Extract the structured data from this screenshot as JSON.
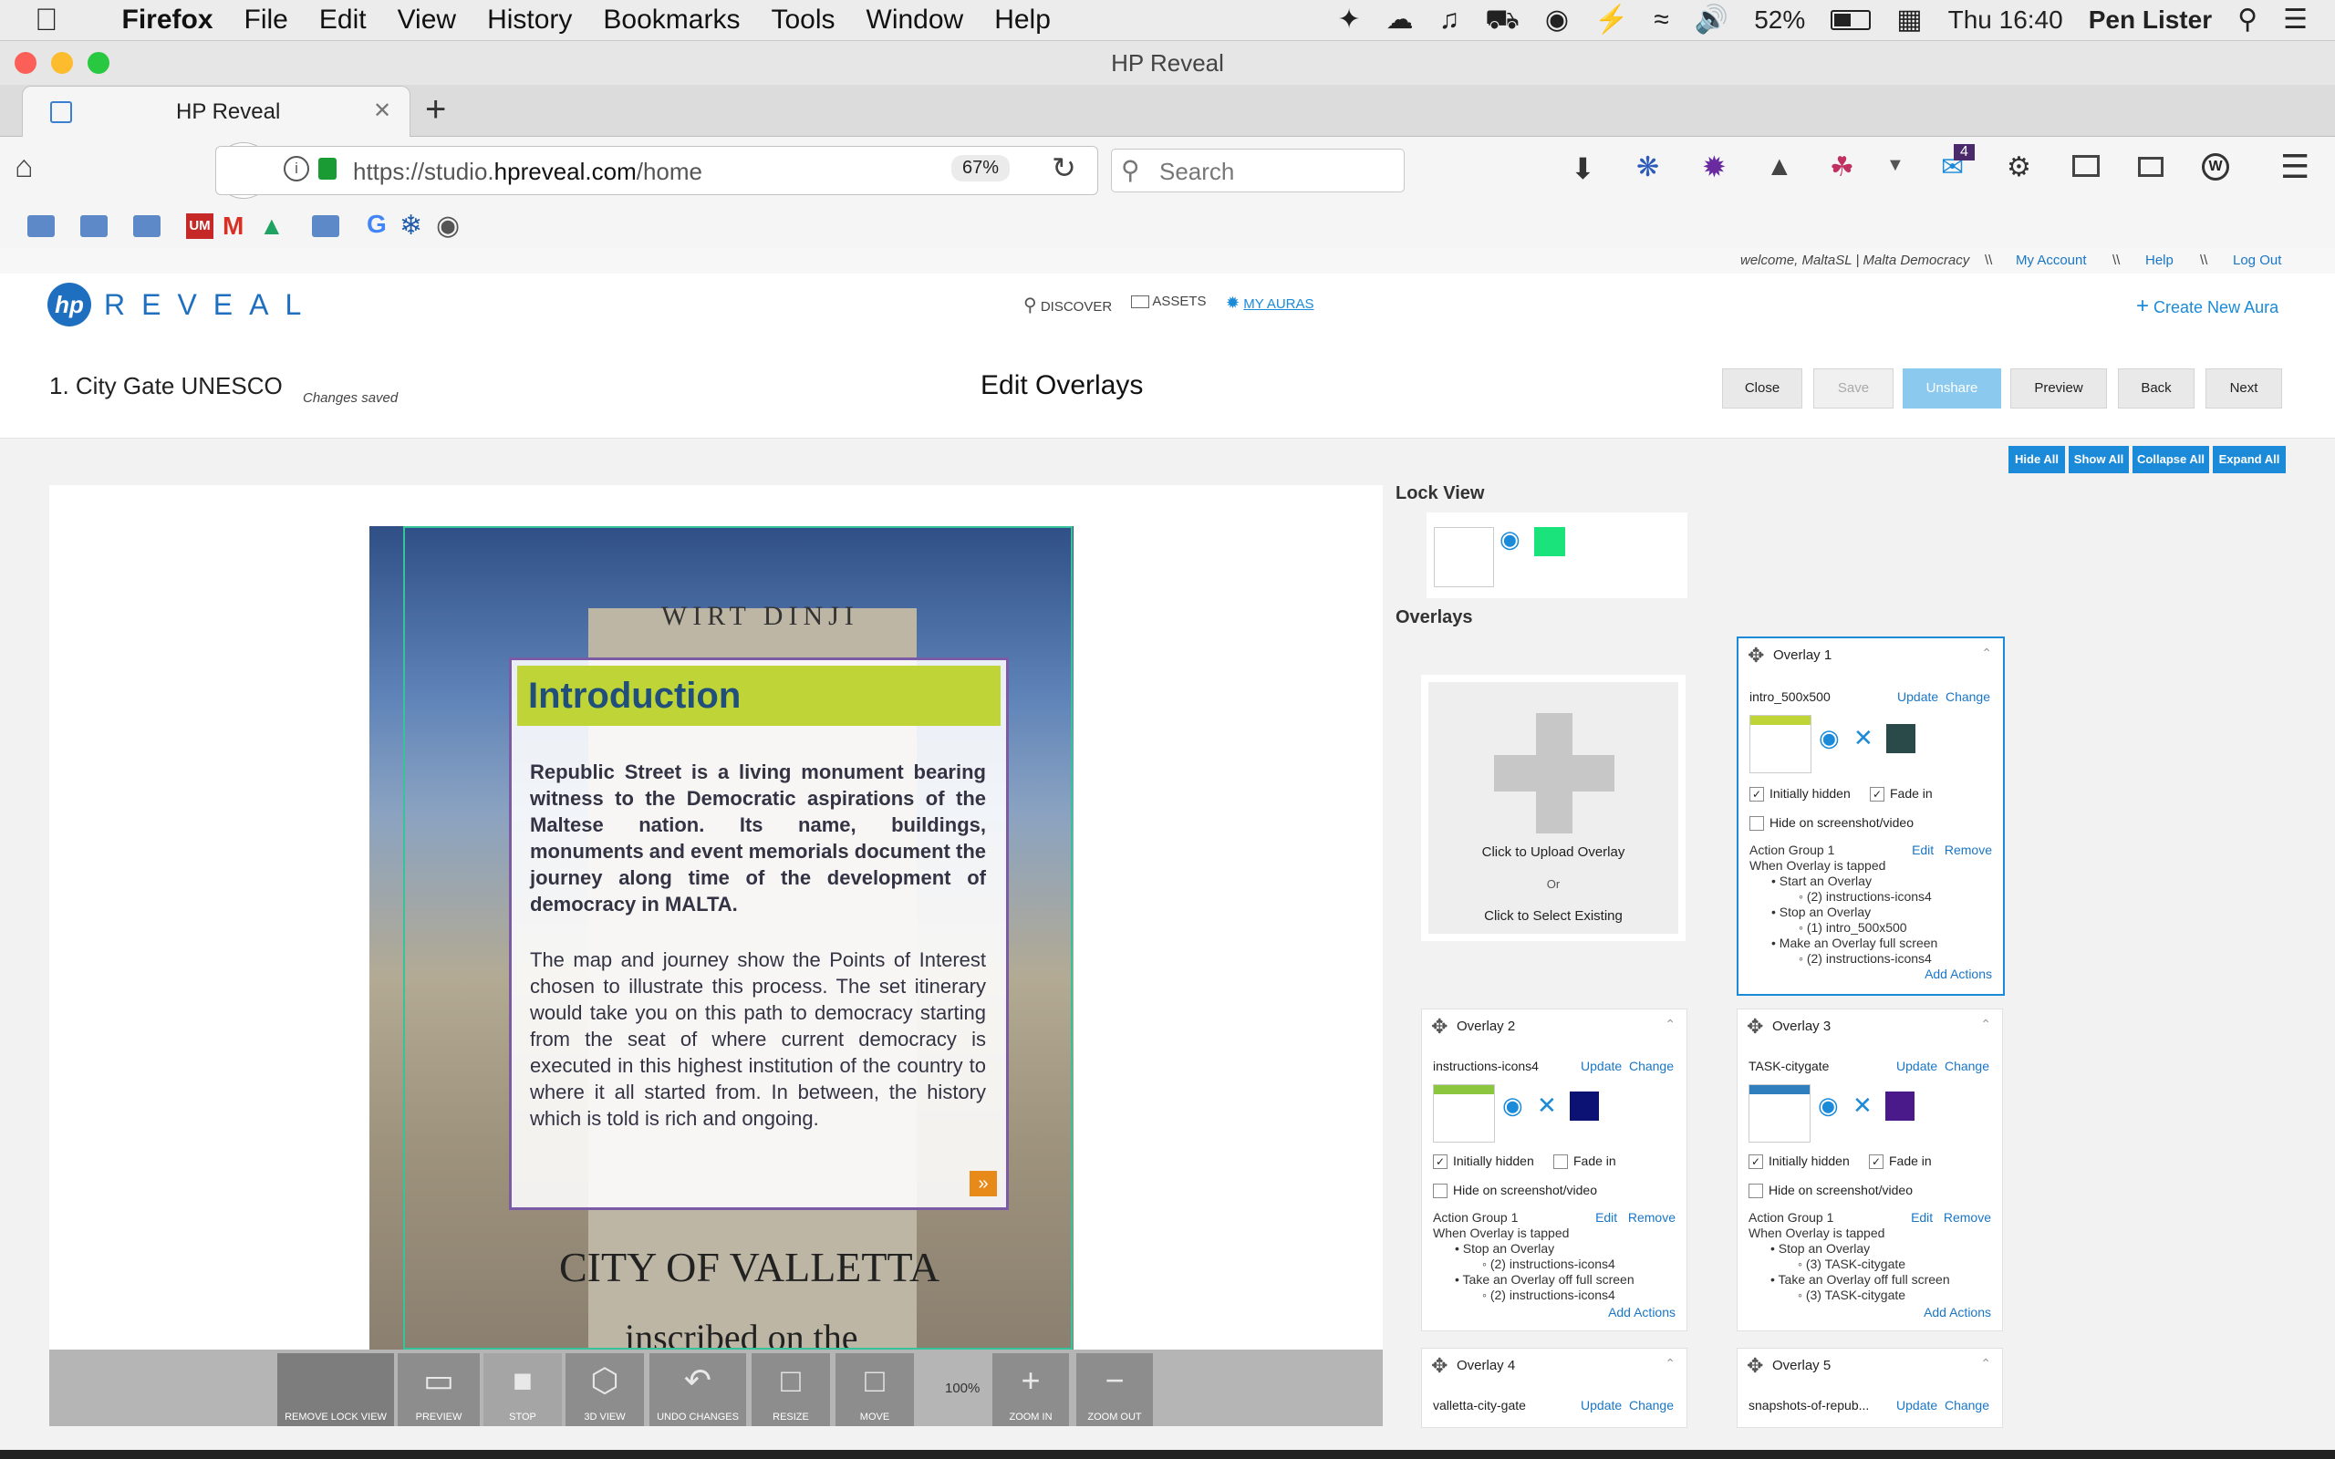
{
  "mac_menu": {
    "items": [
      "Firefox",
      "File",
      "Edit",
      "View",
      "History",
      "Bookmarks",
      "Tools",
      "Window",
      "Help"
    ],
    "battery": "52%",
    "clock": "Thu 16:40",
    "user": "Pen Lister"
  },
  "browser": {
    "window_title": "HP Reveal",
    "tab_title": "HP Reveal",
    "url_prefix": "https://studio.",
    "url_domain": "hpreveal.com",
    "url_path": "/home",
    "zoom": "67%",
    "search_placeholder": "Search",
    "notification_badge": "4"
  },
  "account_bar": {
    "welcome": "welcome, MaltaSL | Malta Democracy",
    "sep": "\\\\",
    "my_account": "My Account",
    "help": "Help",
    "logout": "Log Out"
  },
  "app": {
    "logo": "hp",
    "brand": "REVEAL",
    "nav": {
      "discover": "DISCOVER",
      "assets": "ASSETS",
      "my_auras": "MY AURAS"
    },
    "create": "Create New Aura"
  },
  "edit": {
    "aura_title": "1. City Gate UNESCO",
    "status": "Changes saved",
    "heading": "Edit Overlays",
    "buttons": {
      "close": "Close",
      "save": "Save",
      "unshare": "Unshare",
      "preview": "Preview",
      "back": "Back",
      "next": "Next"
    },
    "panel_buttons": {
      "hide_all": "Hide All",
      "show_all": "Show All",
      "collapse_all": "Collapse All",
      "expand_all": "Expand All"
    }
  },
  "canvas": {
    "intro_title": "Introduction",
    "intro_p1": "Republic Street is a living monument bearing witness to the Democratic aspirations of the Maltese nation. Its name, buildings, monuments and event memorials document the journey along time of the development of democracy in MALTA.",
    "intro_p2": "The map and journey show the Points of Interest chosen to illustrate this process. The set itinerary would take you on this path to democracy starting from the seat of where current democracy is executed in this highest institution of the country to where it all started from. In between, the history which is told is rich and ongoing.",
    "sign_top": "WIRT DINJI",
    "sign_city": "CITY OF VALLETTA",
    "sign_bottom": "inscribed on the",
    "zoom_level": "100%",
    "toolbar": {
      "remove_lock": "REMOVE LOCK VIEW",
      "preview": "PREVIEW",
      "stop": "STOP",
      "view3d": "3D VIEW",
      "undo": "UNDO CHANGES",
      "resize": "RESIZE",
      "move": "MOVE",
      "zoom_in": "ZOOM IN",
      "zoom_out": "ZOOM OUT"
    }
  },
  "lock_view": {
    "title": "Lock View",
    "color": "#19e37a"
  },
  "overlays_panel": {
    "title": "Overlays",
    "upload": "Click to Upload Overlay",
    "or": "Or",
    "select_existing": "Click to Select Existing"
  },
  "overlays": [
    {
      "title": "Overlay 1",
      "name": "intro_500x500",
      "update": "Update",
      "change": "Change",
      "color": "#2a4a4a",
      "initially_hidden": "Initially hidden",
      "fade_in": "Fade in",
      "hide_screenshot": "Hide on screenshot/video",
      "hidden_checked": true,
      "fade_checked": true,
      "screenshot_checked": false,
      "group": "Action Group 1",
      "edit": "Edit",
      "remove": "Remove",
      "trigger": "When Overlay is tapped",
      "actions": [
        {
          "action": "Start an Overlay",
          "target": "(2) instructions-icons4"
        },
        {
          "action": "Stop an Overlay",
          "target": "(1) intro_500x500"
        },
        {
          "action": "Make an Overlay full screen",
          "target": "(2) instructions-icons4"
        }
      ],
      "add_actions": "Add Actions"
    },
    {
      "title": "Overlay 2",
      "name": "instructions-icons4",
      "update": "Update",
      "change": "Change",
      "color": "#0c1273",
      "initially_hidden": "Initially hidden",
      "fade_in": "Fade in",
      "hide_screenshot": "Hide on screenshot/video",
      "hidden_checked": true,
      "fade_checked": false,
      "screenshot_checked": false,
      "group": "Action Group 1",
      "edit": "Edit",
      "remove": "Remove",
      "trigger": "When Overlay is tapped",
      "actions": [
        {
          "action": "Stop an Overlay",
          "target": "(2) instructions-icons4"
        },
        {
          "action": "Take an Overlay off full screen",
          "target": "(2) instructions-icons4"
        }
      ],
      "add_actions": "Add Actions"
    },
    {
      "title": "Overlay 3",
      "name": "TASK-citygate",
      "update": "Update",
      "change": "Change",
      "color": "#4b1a8a",
      "initially_hidden": "Initially hidden",
      "fade_in": "Fade in",
      "hide_screenshot": "Hide on screenshot/video",
      "hidden_checked": true,
      "fade_checked": true,
      "screenshot_checked": false,
      "group": "Action Group 1",
      "edit": "Edit",
      "remove": "Remove",
      "trigger": "When Overlay is tapped",
      "actions": [
        {
          "action": "Stop an Overlay",
          "target": "(3) TASK-citygate"
        },
        {
          "action": "Take an Overlay off full screen",
          "target": "(3) TASK-citygate"
        }
      ],
      "add_actions": "Add Actions"
    },
    {
      "title": "Overlay 4",
      "name": "valletta-city-gate",
      "update": "Update",
      "change": "Change"
    },
    {
      "title": "Overlay 5",
      "name": "snapshots-of-repub...",
      "update": "Update",
      "change": "Change"
    }
  ]
}
